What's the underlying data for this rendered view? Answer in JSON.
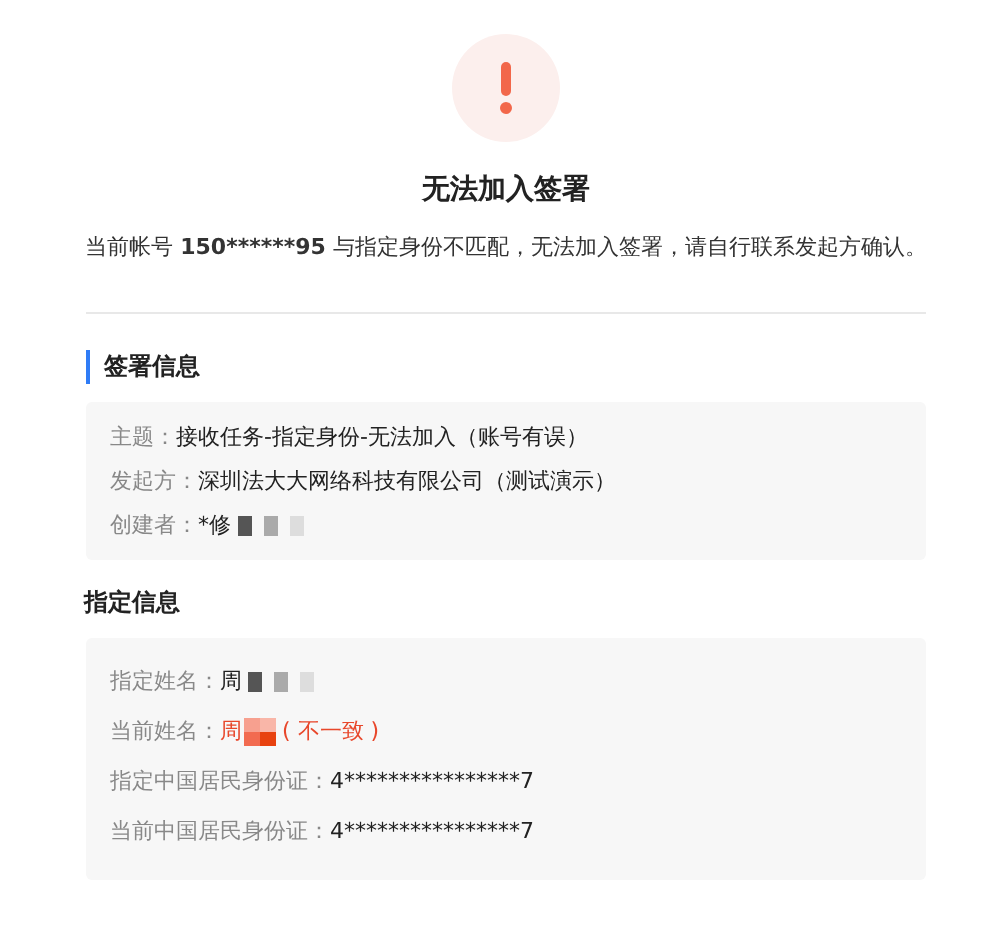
{
  "title": "无法加入签署",
  "message": {
    "before": "当前帐号 ",
    "account": "150******95",
    "after": " 与指定身份不匹配，无法加入签署，请自行联系发起方确认。"
  },
  "sections": [
    {
      "heading": "签署信息",
      "accent": true,
      "rows": [
        {
          "label": "主题：",
          "value": "接收任务-指定身份-无法加入（账号有误）",
          "redacted": false,
          "mismatch": false
        },
        {
          "label": "发起方：",
          "value": "深圳法大大网络科技有限公司（测试演示）",
          "redacted": false,
          "mismatch": false
        },
        {
          "label": "创建者：",
          "value": "*修",
          "redacted": true,
          "mismatch": false
        }
      ]
    },
    {
      "heading": "指定信息",
      "accent": false,
      "rows": [
        {
          "label": "指定姓名：",
          "value": "周",
          "redacted": true,
          "mismatch": false
        },
        {
          "label": "当前姓名：",
          "value": "周",
          "redacted": true,
          "mismatch": true,
          "note": "( 不一致 )"
        },
        {
          "label": "指定中国居民身份证：",
          "value": "4****************7",
          "redacted": false,
          "mismatch": false
        },
        {
          "label": "当前中国居民身份证：",
          "value": "4****************7",
          "redacted": false,
          "mismatch": false
        }
      ]
    }
  ]
}
